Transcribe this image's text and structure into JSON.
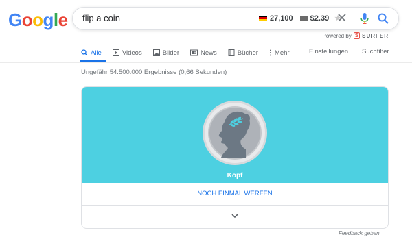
{
  "logo": {
    "letters": [
      "G",
      "o",
      "o",
      "g",
      "l",
      "e"
    ],
    "colors": [
      "#4285f4",
      "#ea4335",
      "#fbbc05",
      "#4285f4",
      "#34a853",
      "#ea4335"
    ]
  },
  "search": {
    "query": "flip a coin"
  },
  "extension": {
    "volume": "27,100",
    "cpc": "$2.39",
    "powered_by": "Powered by",
    "brand": "SURFER",
    "brand_mark": "S"
  },
  "tabs": [
    {
      "label": "Alle",
      "icon": "search-icon"
    },
    {
      "label": "Videos",
      "icon": "play-icon"
    },
    {
      "label": "Bilder",
      "icon": "image-icon"
    },
    {
      "label": "News",
      "icon": "news-icon"
    },
    {
      "label": "Bücher",
      "icon": "book-icon"
    },
    {
      "label": "Mehr",
      "icon": "more-vert-icon"
    }
  ],
  "tools": {
    "settings": "Einstellungen",
    "filter": "Suchfilter"
  },
  "results_stats": "Ungefähr 54.500.000 Ergebnisse (0,66 Sekunden)",
  "coin": {
    "result": "Kopf",
    "flip_again": "NOCH EINMAL WERFEN",
    "background": "#4dd0e1"
  },
  "feedback": "Feedback geben",
  "colors": {
    "accent": "#1a73e8",
    "card_bg": "#4dd0e1"
  }
}
